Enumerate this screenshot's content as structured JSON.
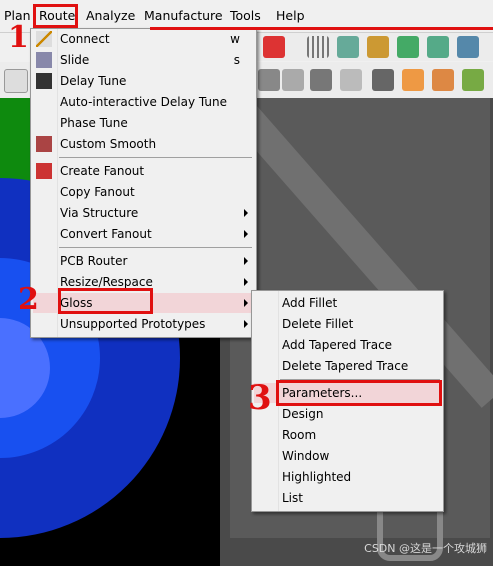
{
  "menubar": {
    "items": [
      "Plan",
      "Route",
      "Analyze",
      "Manufacture",
      "Tools",
      "Help"
    ]
  },
  "route_menu": {
    "groups": [
      [
        {
          "label": "Connect",
          "shortcut": "w",
          "icon": "connect-icon"
        },
        {
          "label": "Slide",
          "shortcut": "s",
          "icon": "slide-icon"
        },
        {
          "label": "Delay Tune",
          "icon": "delay-tune-icon"
        },
        {
          "label": "Auto-interactive Delay Tune"
        },
        {
          "label": "Phase Tune"
        },
        {
          "label": "Custom Smooth",
          "icon": "custom-smooth-icon"
        }
      ],
      [
        {
          "label": "Create Fanout",
          "icon": "create-fanout-icon"
        },
        {
          "label": "Copy Fanout"
        },
        {
          "label": "Via Structure",
          "submenu": true
        },
        {
          "label": "Convert Fanout",
          "submenu": true
        }
      ],
      [
        {
          "label": "PCB Router",
          "submenu": true
        },
        {
          "label": "Resize/Respace",
          "submenu": true
        },
        {
          "label": "Gloss",
          "submenu": true,
          "highlighted": true
        },
        {
          "label": "Unsupported Prototypes",
          "submenu": true
        }
      ]
    ]
  },
  "gloss_submenu": {
    "items": [
      "Add Fillet",
      "Delete Fillet",
      "Add Tapered Trace",
      "Delete Tapered Trace",
      "Parameters...",
      "Design",
      "Room",
      "Window",
      "Highlighted",
      "List"
    ],
    "highlighted": "Parameters..."
  },
  "annotations": {
    "step1": "1",
    "step2": "2",
    "step3": "3",
    "color": "#e01010"
  },
  "watermark": "CSDN @这是一个攻城狮"
}
